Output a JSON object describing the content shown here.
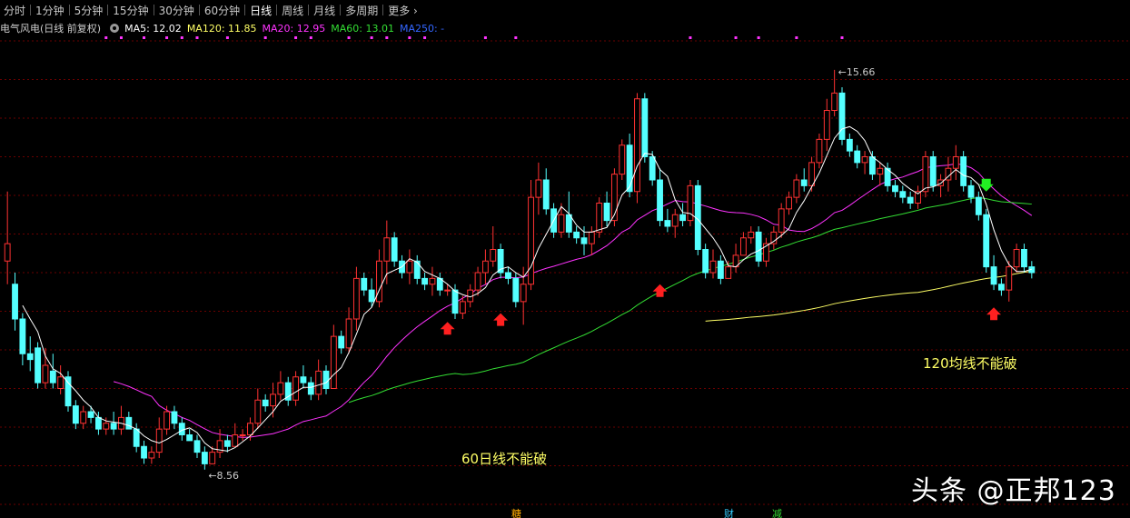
{
  "toolbar": {
    "tabs": [
      "分时",
      "1分钟",
      "5分钟",
      "15分钟",
      "30分钟",
      "60分钟",
      "日线",
      "周线",
      "月线",
      "多周期",
      "更多"
    ],
    "active": "日线"
  },
  "legend": {
    "title": "电气风电(日线 前复权)",
    "items": [
      {
        "label": "MA5: 12.02",
        "color": "#ffffff"
      },
      {
        "label": "MA120: 11.85",
        "color": "#ffff66"
      },
      {
        "label": "MA20: 12.95",
        "color": "#ff33ff"
      },
      {
        "label": "MA60: 13.01",
        "color": "#33dd33"
      },
      {
        "label": "MA250: -",
        "color": "#3366ff"
      }
    ]
  },
  "annotations": {
    "high_label": "15.66",
    "low_label": "8.56",
    "note_60": "60日线不能破",
    "note_120": "120均线不能破",
    "bottom_marks": [
      "糖",
      "财",
      "减"
    ]
  },
  "watermark": "头条 @正邦123",
  "colors": {
    "up": "#ff3232",
    "down": "#54ffff",
    "ma5": "#ffffff",
    "ma20": "#ff33ff",
    "ma60": "#33dd33",
    "ma120": "#ffff66",
    "up_arrow": "#ff2020",
    "down_arrow": "#22ee22"
  },
  "chart_data": {
    "type": "candlestick",
    "ylim": [
      8.2,
      16.2
    ],
    "grid": "horizontal dashed",
    "candles_olhc": [
      [
        12.4,
        12.0,
        13.6,
        12.7
      ],
      [
        12.0,
        11.2,
        12.2,
        11.4
      ],
      [
        11.4,
        10.6,
        11.5,
        10.8
      ],
      [
        10.8,
        10.5,
        11.1,
        10.7
      ],
      [
        10.9,
        10.2,
        11.0,
        10.3
      ],
      [
        10.3,
        10.2,
        10.9,
        10.6
      ],
      [
        10.5,
        10.2,
        10.8,
        10.3
      ],
      [
        10.2,
        10.1,
        10.6,
        10.4
      ],
      [
        10.4,
        9.8,
        10.5,
        9.9
      ],
      [
        9.9,
        9.5,
        10.0,
        9.6
      ],
      [
        9.6,
        9.5,
        9.9,
        9.8
      ],
      [
        9.8,
        9.6,
        9.9,
        9.7
      ],
      [
        9.7,
        9.4,
        9.8,
        9.5
      ],
      [
        9.5,
        9.4,
        9.7,
        9.6
      ],
      [
        9.6,
        9.4,
        9.8,
        9.5
      ],
      [
        9.5,
        9.4,
        9.9,
        9.7
      ],
      [
        9.7,
        9.5,
        9.8,
        9.5
      ],
      [
        9.5,
        9.1,
        9.6,
        9.2
      ],
      [
        9.2,
        8.9,
        9.3,
        9.0
      ],
      [
        9.0,
        8.9,
        9.2,
        9.1
      ],
      [
        9.1,
        9.0,
        9.7,
        9.5
      ],
      [
        9.5,
        9.4,
        9.9,
        9.8
      ],
      [
        9.8,
        9.5,
        9.9,
        9.6
      ],
      [
        9.6,
        9.3,
        9.7,
        9.4
      ],
      [
        9.4,
        9.3,
        9.5,
        9.3
      ],
      [
        9.3,
        9.0,
        9.4,
        9.1
      ],
      [
        9.1,
        8.8,
        9.2,
        8.9
      ],
      [
        8.9,
        8.9,
        9.2,
        9.1
      ],
      [
        9.1,
        9.0,
        9.5,
        9.3
      ],
      [
        9.3,
        9.1,
        9.4,
        9.2
      ],
      [
        9.2,
        9.2,
        9.6,
        9.4
      ],
      [
        9.4,
        9.3,
        9.5,
        9.4
      ],
      [
        9.4,
        9.3,
        9.7,
        9.6
      ],
      [
        9.6,
        9.5,
        10.2,
        10.0
      ],
      [
        10.0,
        9.8,
        10.1,
        9.9
      ],
      [
        9.9,
        9.7,
        10.3,
        10.1
      ],
      [
        10.1,
        10.0,
        10.5,
        10.3
      ],
      [
        10.3,
        9.9,
        10.4,
        10.0
      ],
      [
        10.0,
        9.9,
        10.5,
        10.4
      ],
      [
        10.4,
        10.2,
        10.6,
        10.3
      ],
      [
        10.3,
        10.0,
        10.4,
        10.1
      ],
      [
        10.1,
        10.0,
        10.7,
        10.5
      ],
      [
        10.5,
        10.1,
        10.6,
        10.2
      ],
      [
        10.2,
        10.2,
        11.3,
        11.1
      ],
      [
        11.1,
        10.8,
        11.2,
        10.9
      ],
      [
        10.9,
        10.8,
        11.6,
        11.4
      ],
      [
        11.4,
        11.2,
        12.3,
        12.1
      ],
      [
        12.1,
        11.8,
        12.2,
        11.9
      ],
      [
        11.9,
        11.6,
        12.1,
        11.7
      ],
      [
        11.7,
        11.6,
        12.6,
        12.4
      ],
      [
        12.4,
        12.0,
        13.1,
        12.8
      ],
      [
        12.8,
        12.3,
        12.9,
        12.4
      ],
      [
        12.4,
        12.1,
        12.5,
        12.2
      ],
      [
        12.2,
        12.0,
        12.6,
        12.4
      ],
      [
        12.4,
        12.0,
        12.5,
        12.1
      ],
      [
        12.1,
        11.9,
        12.2,
        12.0
      ],
      [
        12.0,
        11.8,
        12.3,
        12.1
      ],
      [
        12.1,
        11.8,
        12.2,
        11.9
      ],
      [
        11.9,
        11.8,
        12.0,
        11.9
      ],
      [
        11.9,
        11.4,
        12.0,
        11.5
      ],
      [
        11.5,
        11.4,
        11.8,
        11.7
      ],
      [
        11.7,
        11.6,
        12.0,
        11.9
      ],
      [
        11.9,
        11.8,
        12.3,
        12.2
      ],
      [
        12.2,
        12.0,
        12.6,
        12.4
      ],
      [
        12.4,
        12.3,
        13.0,
        12.6
      ],
      [
        12.6,
        12.1,
        12.7,
        12.2
      ],
      [
        12.2,
        12.0,
        12.3,
        12.1
      ],
      [
        12.1,
        11.6,
        12.2,
        11.7
      ],
      [
        11.7,
        11.3,
        12.3,
        12.0
      ],
      [
        12.0,
        11.9,
        13.8,
        13.5
      ],
      [
        13.5,
        13.2,
        14.1,
        13.8
      ],
      [
        13.8,
        13.2,
        14.0,
        13.3
      ],
      [
        13.3,
        12.8,
        13.4,
        12.9
      ],
      [
        12.9,
        12.8,
        13.4,
        13.2
      ],
      [
        13.2,
        12.8,
        13.6,
        12.9
      ],
      [
        12.9,
        12.7,
        13.0,
        12.8
      ],
      [
        12.8,
        12.5,
        13.0,
        12.7
      ],
      [
        12.7,
        12.5,
        13.0,
        12.9
      ],
      [
        12.9,
        12.8,
        13.5,
        13.4
      ],
      [
        13.4,
        13.0,
        13.6,
        13.1
      ],
      [
        13.1,
        13.0,
        14.0,
        13.9
      ],
      [
        13.9,
        13.8,
        14.5,
        14.4
      ],
      [
        14.4,
        13.5,
        14.6,
        13.6
      ],
      [
        13.6,
        13.4,
        15.3,
        15.2
      ],
      [
        15.2,
        14.1,
        15.3,
        14.2
      ],
      [
        14.2,
        13.7,
        14.3,
        13.8
      ],
      [
        13.8,
        13.0,
        14.0,
        13.1
      ],
      [
        13.1,
        12.9,
        13.3,
        13.0
      ],
      [
        13.0,
        12.8,
        13.3,
        13.2
      ],
      [
        13.2,
        13.0,
        13.4,
        13.1
      ],
      [
        13.1,
        13.0,
        13.8,
        13.7
      ],
      [
        13.7,
        12.5,
        13.8,
        12.6
      ],
      [
        12.6,
        12.1,
        12.7,
        12.2
      ],
      [
        12.2,
        12.1,
        12.6,
        12.4
      ],
      [
        12.4,
        12.0,
        12.5,
        12.1
      ],
      [
        12.1,
        12.1,
        12.4,
        12.3
      ],
      [
        12.3,
        12.2,
        12.7,
        12.5
      ],
      [
        12.5,
        12.5,
        12.9,
        12.8
      ],
      [
        12.8,
        12.7,
        13.0,
        12.9
      ],
      [
        12.9,
        12.3,
        13.0,
        12.4
      ],
      [
        12.4,
        12.3,
        12.8,
        12.7
      ],
      [
        12.7,
        12.6,
        13.0,
        12.9
      ],
      [
        12.9,
        12.8,
        13.4,
        13.3
      ],
      [
        13.3,
        13.2,
        13.6,
        13.5
      ],
      [
        13.5,
        13.4,
        13.9,
        13.8
      ],
      [
        13.8,
        13.6,
        14.0,
        13.7
      ],
      [
        13.7,
        13.6,
        14.2,
        14.1
      ],
      [
        14.1,
        14.0,
        14.6,
        14.5
      ],
      [
        14.5,
        14.3,
        15.2,
        15.0
      ],
      [
        15.0,
        14.9,
        15.7,
        15.3
      ],
      [
        15.3,
        14.4,
        15.4,
        14.5
      ],
      [
        14.5,
        14.2,
        14.6,
        14.3
      ],
      [
        14.3,
        14.0,
        14.4,
        14.1
      ],
      [
        14.1,
        13.9,
        14.3,
        14.2
      ],
      [
        14.2,
        13.8,
        14.3,
        13.9
      ],
      [
        13.9,
        13.7,
        14.1,
        14.0
      ],
      [
        14.0,
        13.6,
        14.1,
        13.7
      ],
      [
        13.7,
        13.5,
        13.8,
        13.6
      ],
      [
        13.6,
        13.4,
        13.7,
        13.5
      ],
      [
        13.5,
        13.3,
        13.6,
        13.4
      ],
      [
        13.4,
        13.3,
        13.7,
        13.6
      ],
      [
        13.6,
        13.5,
        14.3,
        14.2
      ],
      [
        14.2,
        13.6,
        14.3,
        13.7
      ],
      [
        13.7,
        13.5,
        13.9,
        13.8
      ],
      [
        13.8,
        13.6,
        14.2,
        14.0
      ],
      [
        14.0,
        13.8,
        14.4,
        14.2
      ],
      [
        14.2,
        13.6,
        14.3,
        13.7
      ],
      [
        13.7,
        13.4,
        13.8,
        13.5
      ],
      [
        13.5,
        13.1,
        13.6,
        13.2
      ],
      [
        13.2,
        12.2,
        13.3,
        12.3
      ],
      [
        12.3,
        11.9,
        12.5,
        12.0
      ],
      [
        12.0,
        11.8,
        12.1,
        11.9
      ],
      [
        11.9,
        11.7,
        12.4,
        12.3
      ],
      [
        12.3,
        12.2,
        12.7,
        12.6
      ],
      [
        12.6,
        12.2,
        12.7,
        12.3
      ],
      [
        12.3,
        12.1,
        12.4,
        12.2
      ]
    ],
    "high": 15.66,
    "low": 8.56
  }
}
